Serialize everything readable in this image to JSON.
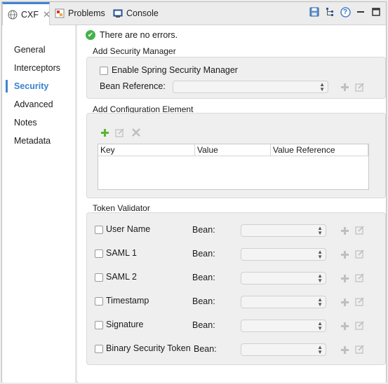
{
  "tabs": [
    {
      "label": "CXF",
      "icon": "cxf-globe-icon",
      "active": true
    },
    {
      "label": "Problems",
      "icon": "problems-icon",
      "active": false
    },
    {
      "label": "Console",
      "icon": "console-icon",
      "active": false
    }
  ],
  "toolbar": {
    "icons": [
      "save-icon",
      "tree-icon",
      "help-icon",
      "minimize-icon",
      "maximize-icon"
    ],
    "help_glyph": "?"
  },
  "nav": {
    "items": [
      {
        "label": "General"
      },
      {
        "label": "Interceptors"
      },
      {
        "label": "Security"
      },
      {
        "label": "Advanced"
      },
      {
        "label": "Notes"
      },
      {
        "label": "Metadata"
      }
    ],
    "active_index": 2
  },
  "status": {
    "text": "There are no errors."
  },
  "security_manager": {
    "title": "Add Security Manager",
    "checkbox_label": "Enable Spring Security Manager",
    "checked": false,
    "bean_reference_label": "Bean Reference:",
    "bean_reference_value": ""
  },
  "config": {
    "title": "Add Configuration Element",
    "columns": [
      "Key",
      "Value",
      "Value Reference"
    ],
    "rows": []
  },
  "token_validator": {
    "title": "Token Validator",
    "bean_label": "Bean:",
    "rows": [
      {
        "label": "User Name",
        "checked": false,
        "bean": ""
      },
      {
        "label": "SAML 1",
        "checked": false,
        "bean": ""
      },
      {
        "label": "SAML 2",
        "checked": false,
        "bean": ""
      },
      {
        "label": "Timestamp",
        "checked": false,
        "bean": ""
      },
      {
        "label": "Signature",
        "checked": false,
        "bean": ""
      },
      {
        "label": "Binary Security Token",
        "checked": false,
        "bean": ""
      }
    ]
  },
  "colors": {
    "accent": "#3f86d6",
    "ok_green": "#42b34a",
    "add_green": "#5cb531",
    "disabled_icon": "#b7b7b7"
  }
}
